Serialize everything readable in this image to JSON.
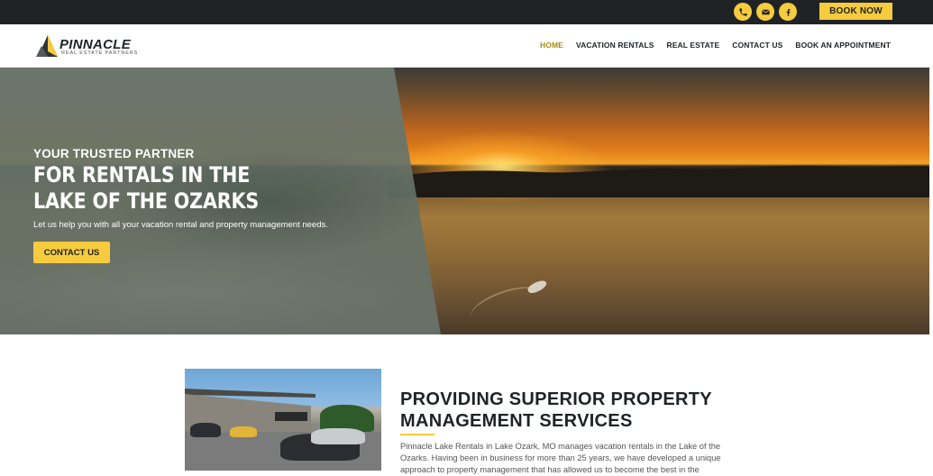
{
  "topbar": {
    "icons": [
      "phone-icon",
      "mail-icon",
      "facebook-icon"
    ],
    "book_now_label": "BOOK NOW"
  },
  "colors": {
    "accent": "#f6cb3e",
    "dark": "#1f2326",
    "nav_active": "#a98a14"
  },
  "header": {
    "logo_text": "PINNACLE",
    "logo_subtext": "REAL ESTATE PARTNERS",
    "nav": [
      {
        "label": "HOME",
        "active": true
      },
      {
        "label": "VACATION RENTALS",
        "active": false
      },
      {
        "label": "REAL ESTATE",
        "active": false
      },
      {
        "label": "CONTACT US",
        "active": false
      },
      {
        "label": "BOOK AN APPOINTMENT",
        "active": false
      }
    ]
  },
  "hero": {
    "eyebrow": "YOUR TRUSTED PARTNER",
    "title": "FOR RENTALS IN THE LAKE OF THE OZARKS",
    "subtitle": "Let us help you with all your vacation rental and property management needs.",
    "cta_label": "CONTACT US"
  },
  "section": {
    "title_line1": "PROVIDING SUPERIOR PROPERTY",
    "title_line2": "MANAGEMENT SERVICES",
    "body": "Pinnacle Lake Rentals in Lake Ozark, MO manages vacation rentals in the Lake of the Ozarks. Having been in business for more than 25 years, we have developed a unique approach to property management that has allowed us to become the best in the"
  }
}
